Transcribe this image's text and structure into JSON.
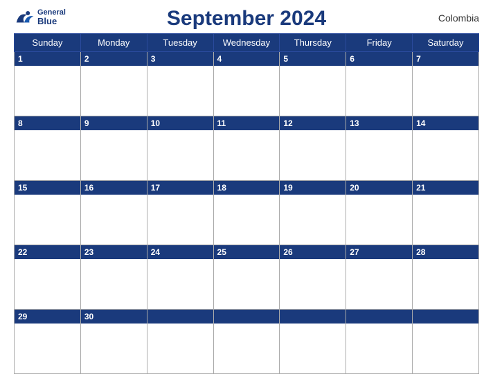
{
  "header": {
    "title": "September 2024",
    "country": "Colombia",
    "logo": {
      "line1": "General",
      "line2": "Blue"
    }
  },
  "days": [
    "Sunday",
    "Monday",
    "Tuesday",
    "Wednesday",
    "Thursday",
    "Friday",
    "Saturday"
  ],
  "weeks": [
    [
      1,
      2,
      3,
      4,
      5,
      6,
      7
    ],
    [
      8,
      9,
      10,
      11,
      12,
      13,
      14
    ],
    [
      15,
      16,
      17,
      18,
      19,
      20,
      21
    ],
    [
      22,
      23,
      24,
      25,
      26,
      27,
      28
    ],
    [
      29,
      30,
      null,
      null,
      null,
      null,
      null
    ]
  ]
}
